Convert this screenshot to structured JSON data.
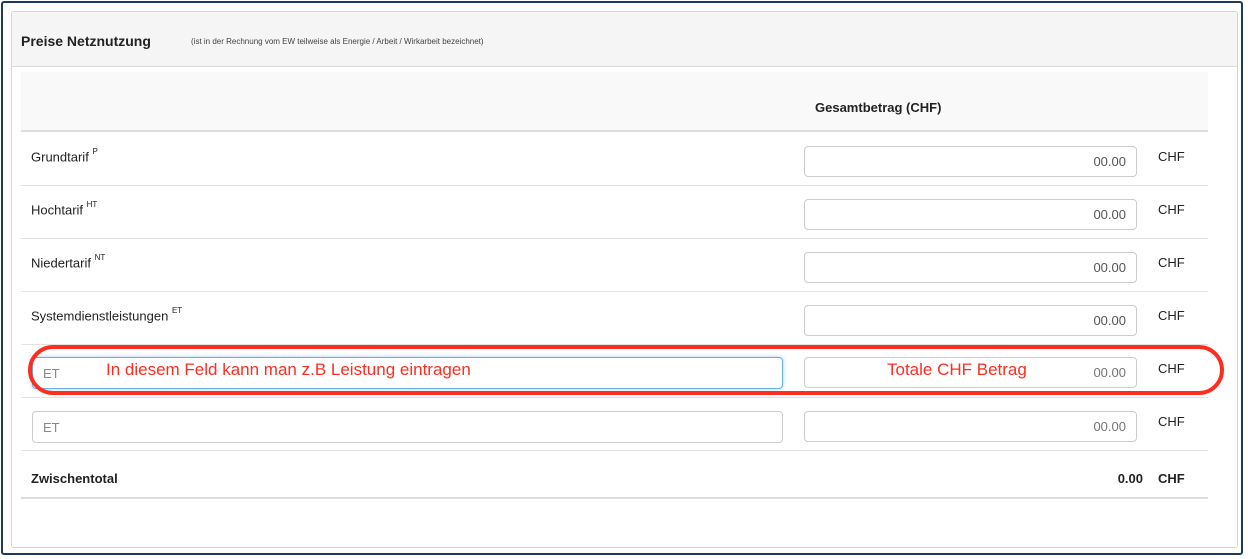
{
  "panel": {
    "title": "Preise Netznutzung",
    "note": "(ist in der Rechnung vom EW teilweise als Energie / Arbeit / Wirkarbeit bezeichnet)"
  },
  "table": {
    "header_total": "Gesamtbetrag (CHF)",
    "rows": [
      {
        "label": "Grundtarif",
        "sup": "P",
        "value": "00.00",
        "unit": "CHF"
      },
      {
        "label": "Hochtarif",
        "sup": "HT",
        "value": "00.00",
        "unit": "CHF"
      },
      {
        "label": "Niedertarif",
        "sup": "NT",
        "value": "00.00",
        "unit": "CHF"
      },
      {
        "label": "Systemdienstleistungen",
        "sup": "ET",
        "value": "00.00",
        "unit": "CHF"
      }
    ],
    "custom_rows": [
      {
        "placeholder": "ET",
        "value_placeholder": "00.00",
        "unit": "CHF"
      },
      {
        "placeholder": "ET",
        "value_placeholder": "00.00",
        "unit": "CHF"
      }
    ],
    "subtotal": {
      "label": "Zwischentotal",
      "value": "0.00",
      "unit": "CHF"
    }
  },
  "annotations": {
    "left": "In diesem Feld kann man z.B Leistung eintragen",
    "right": "Totale CHF Betrag",
    "color": "#ff2d20"
  }
}
